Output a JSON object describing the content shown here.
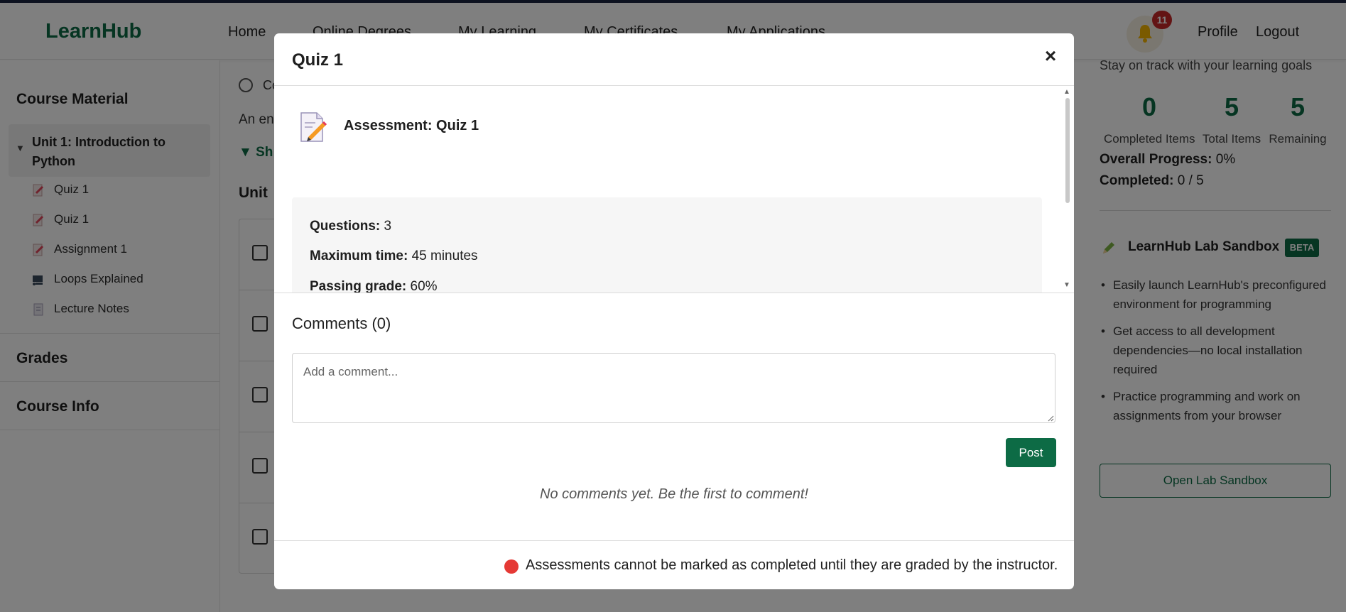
{
  "navbar": {
    "brand": "LearnHub",
    "links": [
      "Home",
      "Online Degrees",
      "My Learning",
      "My Certificates",
      "My Applications"
    ],
    "notification_count": "11",
    "profile": "Profile",
    "logout": "Logout"
  },
  "sidebar": {
    "course_material": "Course Material",
    "unit_title": "Unit 1: Introduction to Python",
    "items": [
      {
        "label": "Quiz 1",
        "icon": "quiz-icon"
      },
      {
        "label": "Quiz 1",
        "icon": "quiz-icon"
      },
      {
        "label": "Assignment 1",
        "icon": "assignment-icon"
      },
      {
        "label": "Loops Explained",
        "icon": "video-icon"
      },
      {
        "label": "Lecture Notes",
        "icon": "document-icon"
      }
    ],
    "grades": "Grades",
    "course_info": "Course Info"
  },
  "main": {
    "clock_text": "Co",
    "description": "An en",
    "show_toggle": "▼ Sh",
    "unit_heading": "Unit "
  },
  "right_panel": {
    "subtitle": "Stay on track with your learning goals",
    "stats": [
      {
        "value": "0",
        "label": "Completed Items"
      },
      {
        "value": "5",
        "label": "Total Items"
      },
      {
        "value": "5",
        "label": "Remaining"
      }
    ],
    "overall_label": "Overall Progress:",
    "overall_value": "0%",
    "completed_label": "Completed:",
    "completed_value": "0 / 5",
    "lab_title": "LearnHub Lab Sandbox",
    "lab_badge": "BETA",
    "lab_bullets": [
      "Easily launch LearnHub's preconfigured environment for programming",
      "Get access to all development dependencies—no local installation required",
      "Practice programming and work on assignments from your browser"
    ],
    "lab_button": "Open Lab Sandbox"
  },
  "modal": {
    "title": "Quiz 1",
    "close": "×",
    "assessment_title": "Assessment: Quiz 1",
    "questions_label": "Questions:",
    "questions_value": "3",
    "max_time_label": "Maximum time:",
    "max_time_value": "45 minutes",
    "passing_label": "Passing grade:",
    "passing_value": "60%",
    "comments_title": "Comments (0)",
    "comment_placeholder": "Add a comment...",
    "post_button": "Post",
    "no_comments": "No comments yet. Be the first to comment!",
    "footer_note": "Assessments cannot be marked as completed until they are graded by the instructor."
  },
  "colors": {
    "brand": "#0d6b45",
    "badge": "#c62828",
    "status_dot": "#e53935"
  }
}
